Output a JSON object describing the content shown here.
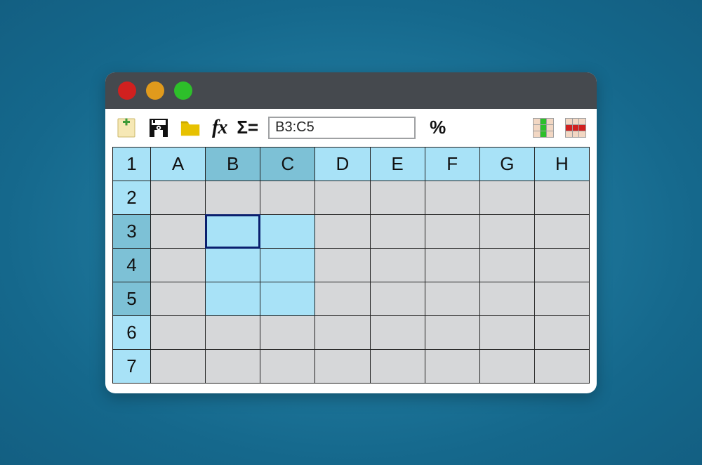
{
  "toolbar": {
    "fx_label": "fx",
    "sigma_label": "Σ=",
    "percent_label": "%",
    "formula_value": "B3:C5"
  },
  "sheet": {
    "corner": "1",
    "columns": [
      "A",
      "B",
      "C",
      "D",
      "E",
      "F",
      "G",
      "H"
    ],
    "rows": [
      "2",
      "3",
      "4",
      "5",
      "6",
      "7"
    ],
    "selected_cols": [
      "B",
      "C"
    ],
    "selected_rows": [
      "3",
      "4",
      "5"
    ],
    "active_cell": {
      "col": "B",
      "row": "3"
    }
  }
}
